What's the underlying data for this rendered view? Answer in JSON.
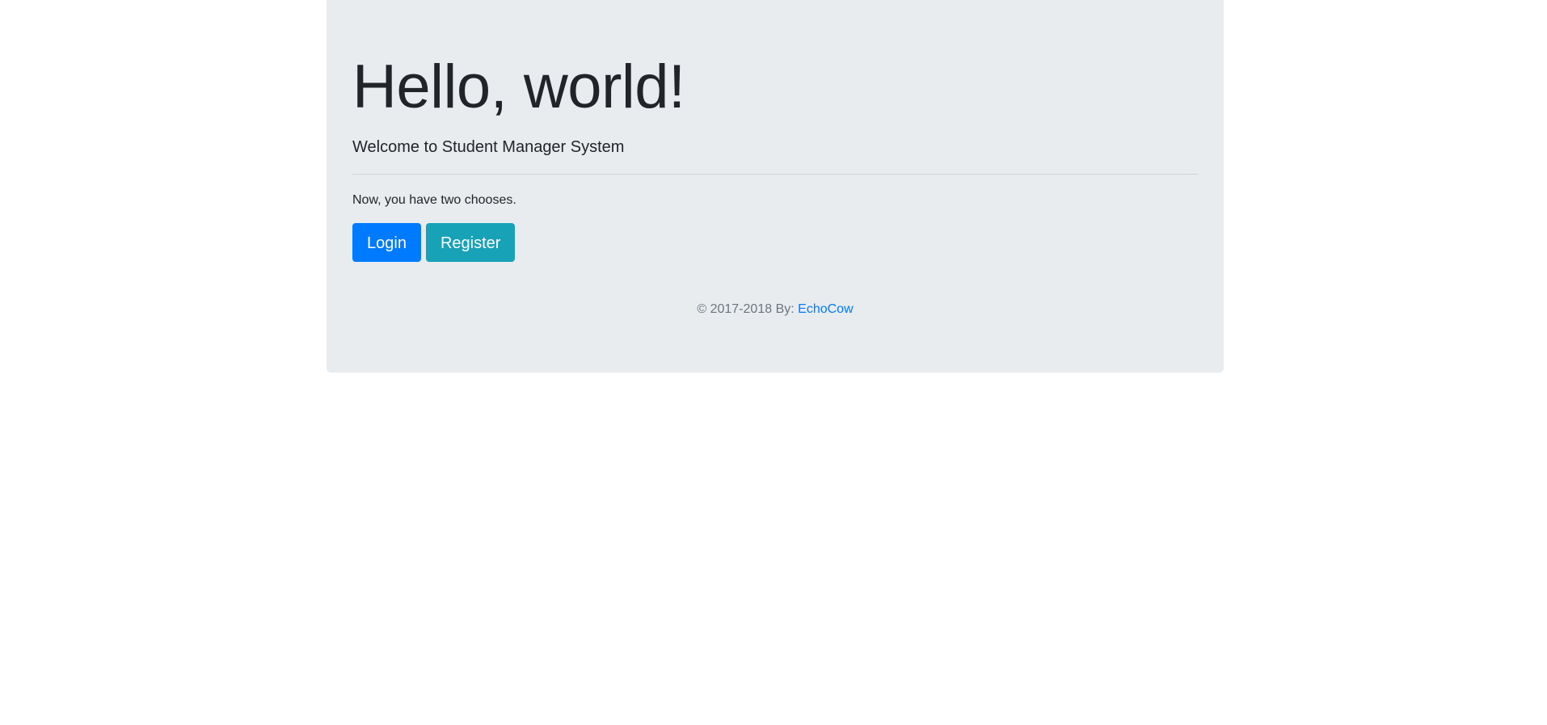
{
  "jumbotron": {
    "title": "Hello, world!",
    "lead": "Welcome to Student Manager System",
    "intro": "Now, you have two chooses."
  },
  "actions": {
    "login_label": "Login",
    "register_label": "Register"
  },
  "footer": {
    "prefix": "© 2017-2018 By:",
    "author_link": "EchoCow"
  },
  "colors": {
    "jumbotron_bg": "#e9ecef",
    "primary": "#007bff",
    "info": "#17a2b8",
    "muted_text": "#6c757d"
  }
}
